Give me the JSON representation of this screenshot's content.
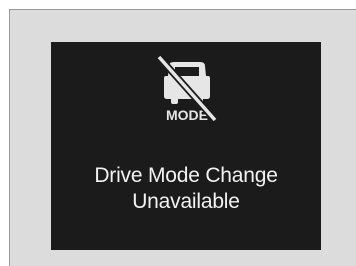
{
  "screen": {
    "icon_name": "drive-mode-unavailable-icon",
    "icon_label": "MODE",
    "message_line1": "Drive Mode Change",
    "message_line2": "Unavailable"
  },
  "colors": {
    "panel_background": "#dcdcdc",
    "screen_background": "#1b1b1b",
    "icon_color": "#e6e6e6",
    "text_color": "#f2f2f2"
  }
}
